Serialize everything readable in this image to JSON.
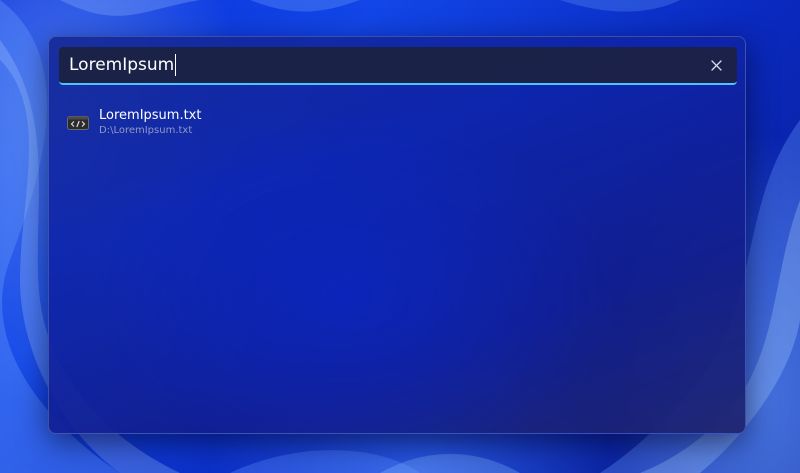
{
  "search": {
    "query": "LoremIpsum",
    "clear_icon": "close-icon"
  },
  "results": [
    {
      "title": "LoremIpsum.txt",
      "path": "D:\\LoremIpsum.txt",
      "icon": "code-file-icon"
    }
  ],
  "colors": {
    "accent": "#4cc2ff",
    "panel": "#122496",
    "text": "#ffffff",
    "subtext": "#8f99c4"
  }
}
